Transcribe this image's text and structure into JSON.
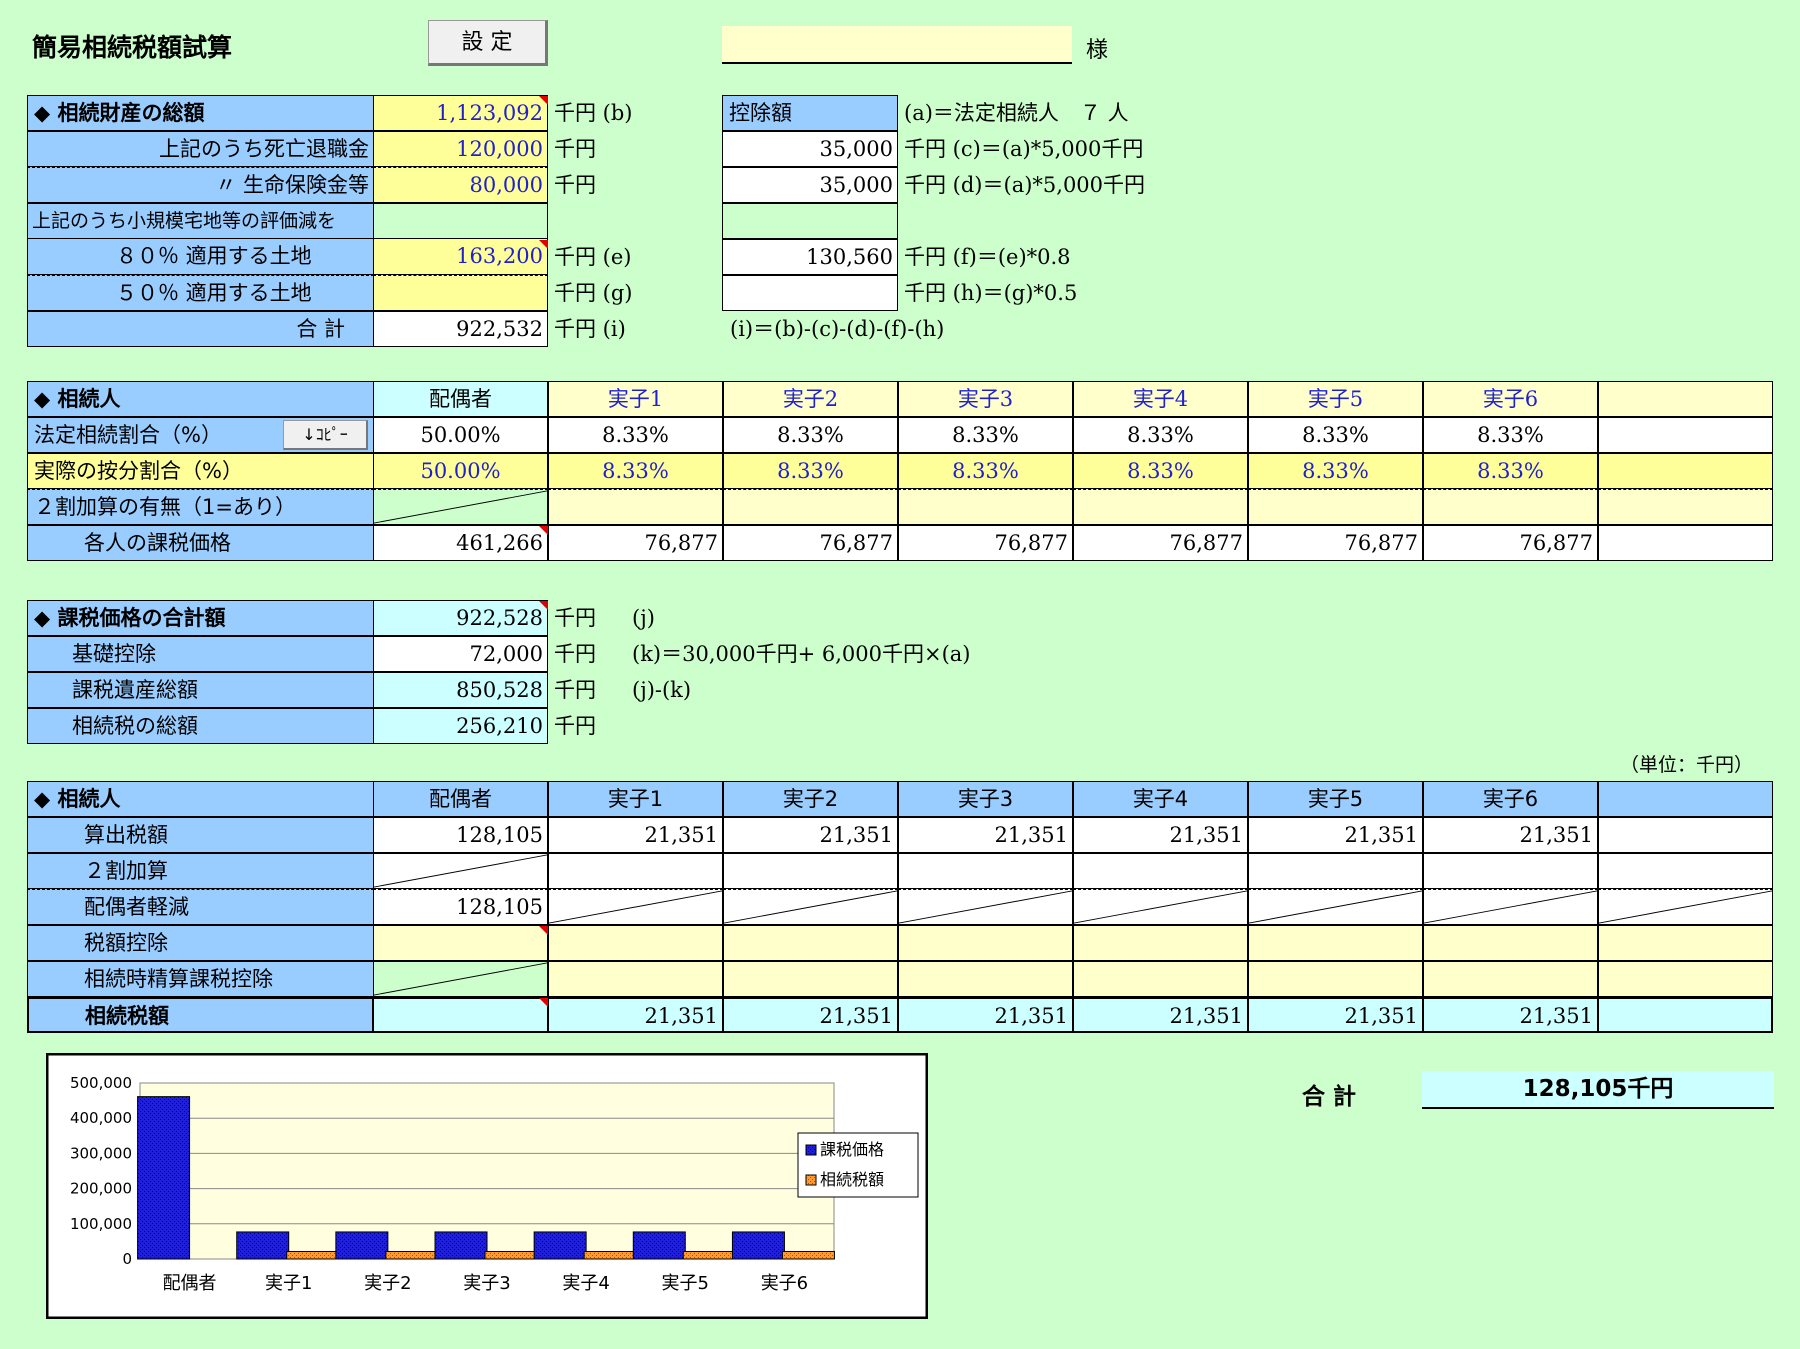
{
  "header": {
    "title": "簡易相続税額試算",
    "settings_button": "設 定",
    "name_value": "",
    "honorific": "様"
  },
  "assets": {
    "rows": [
      {
        "label": "◆ 相続財産の総額",
        "value": "1,123,092",
        "unit": "千円 (b)"
      },
      {
        "label": "上記のうち死亡退職金",
        "value": "120,000",
        "unit": "千円"
      },
      {
        "label": "〃 生命保険金等",
        "value": "80,000",
        "unit": "千円"
      },
      {
        "label": "上記のうち小規模宅地等の評価減を",
        "value": "",
        "unit": ""
      },
      {
        "label": "８０％ 適用する土地",
        "value": "163,200",
        "unit": "千円 (e)"
      },
      {
        "label": "５０％ 適用する土地",
        "value": "",
        "unit": "千円 (g)"
      },
      {
        "label": "合 計",
        "value": "922,532",
        "unit": "千円 (i)"
      }
    ],
    "deduction_header": "控除額",
    "heirs_note": "(a)＝法定相続人　７ 人",
    "deductions": [
      {
        "value": "35,000",
        "note": "千円 (c)＝(a)*5,000千円"
      },
      {
        "value": "35,000",
        "note": "千円 (d)＝(a)*5,000千円"
      },
      {
        "value": "130,560",
        "note": "千円 (f)＝(e)*0.8"
      },
      {
        "value": "",
        "note": "千円 (h)＝(g)*0.5"
      }
    ],
    "formula_i": "(i)＝(b)-(c)-(d)-(f)-(h)"
  },
  "heirs": {
    "header_label": "◆ 相続人",
    "names": [
      "配偶者",
      "実子1",
      "実子2",
      "実子3",
      "実子4",
      "実子5",
      "実子6",
      ""
    ],
    "legal_ratio_label": "法定相続割合（%）",
    "copy_button": "↓ｺﾋﾟｰ",
    "legal_ratios": [
      "50.00%",
      "8.33%",
      "8.33%",
      "8.33%",
      "8.33%",
      "8.33%",
      "8.33%",
      ""
    ],
    "actual_ratio_label": "実際の按分割合（%）",
    "actual_ratios": [
      "50.00%",
      "8.33%",
      "8.33%",
      "8.33%",
      "8.33%",
      "8.33%",
      "8.33%",
      ""
    ],
    "surcharge_label": "２割加算の有無（1=あり）",
    "taxable_label": "各人の課税価格",
    "taxable_values": [
      "461,266",
      "76,877",
      "76,877",
      "76,877",
      "76,877",
      "76,877",
      "76,877",
      ""
    ]
  },
  "summary": {
    "rows": [
      {
        "label": "◆ 課税価格の合計額",
        "value": "922,528",
        "unit": "千円",
        "note": "(j)"
      },
      {
        "label": "基礎控除",
        "value": "72,000",
        "unit": "千円",
        "note": "(k)＝30,000千円+ 6,000千円×(a)"
      },
      {
        "label": "課税遺産総額",
        "value": "850,528",
        "unit": "千円",
        "note": "(j)-(k)"
      },
      {
        "label": "相続税の総額",
        "value": "256,210",
        "unit": "千円",
        "note": ""
      }
    ]
  },
  "taxes": {
    "unit_note": "（単位：千円）",
    "header_label": "◆ 相続人",
    "names": [
      "配偶者",
      "実子1",
      "実子2",
      "実子3",
      "実子4",
      "実子5",
      "実子6",
      ""
    ],
    "calc_label": "算出税額",
    "calc_values": [
      "128,105",
      "21,351",
      "21,351",
      "21,351",
      "21,351",
      "21,351",
      "21,351",
      ""
    ],
    "surcharge_label": "２割加算",
    "spouse_label": "配偶者軽減",
    "spouse_value": "128,105",
    "credit_label": "税額控除",
    "settlement_label": "相続時精算課税控除",
    "final_label": "相続税額",
    "final_values": [
      "",
      "21,351",
      "21,351",
      "21,351",
      "21,351",
      "21,351",
      "21,351",
      ""
    ]
  },
  "total": {
    "label": "合 計",
    "value": "128,105千円"
  },
  "colors": {
    "background": "#ccffcc",
    "label_blue": "#99ccff",
    "input_yellow": "#ffff99",
    "light_yellow": "#ffffcc",
    "result_cyan": "#ccffff",
    "series_taxable": "#1f1fd9",
    "series_tax": "#ff9933"
  },
  "chart_data": {
    "type": "bar",
    "categories": [
      "配偶者",
      "実子1",
      "実子2",
      "実子3",
      "実子4",
      "実子5",
      "実子6"
    ],
    "series": [
      {
        "name": "課税価格",
        "values": [
          461266,
          76877,
          76877,
          76877,
          76877,
          76877,
          76877
        ]
      },
      {
        "name": "相続税額",
        "values": [
          0,
          21351,
          21351,
          21351,
          21351,
          21351,
          21351
        ]
      }
    ],
    "ylim": [
      0,
      500000
    ],
    "y_ticks": [
      "0",
      "100,000",
      "200,000",
      "300,000",
      "400,000",
      "500,000"
    ],
    "grid": true,
    "legend": "right"
  }
}
